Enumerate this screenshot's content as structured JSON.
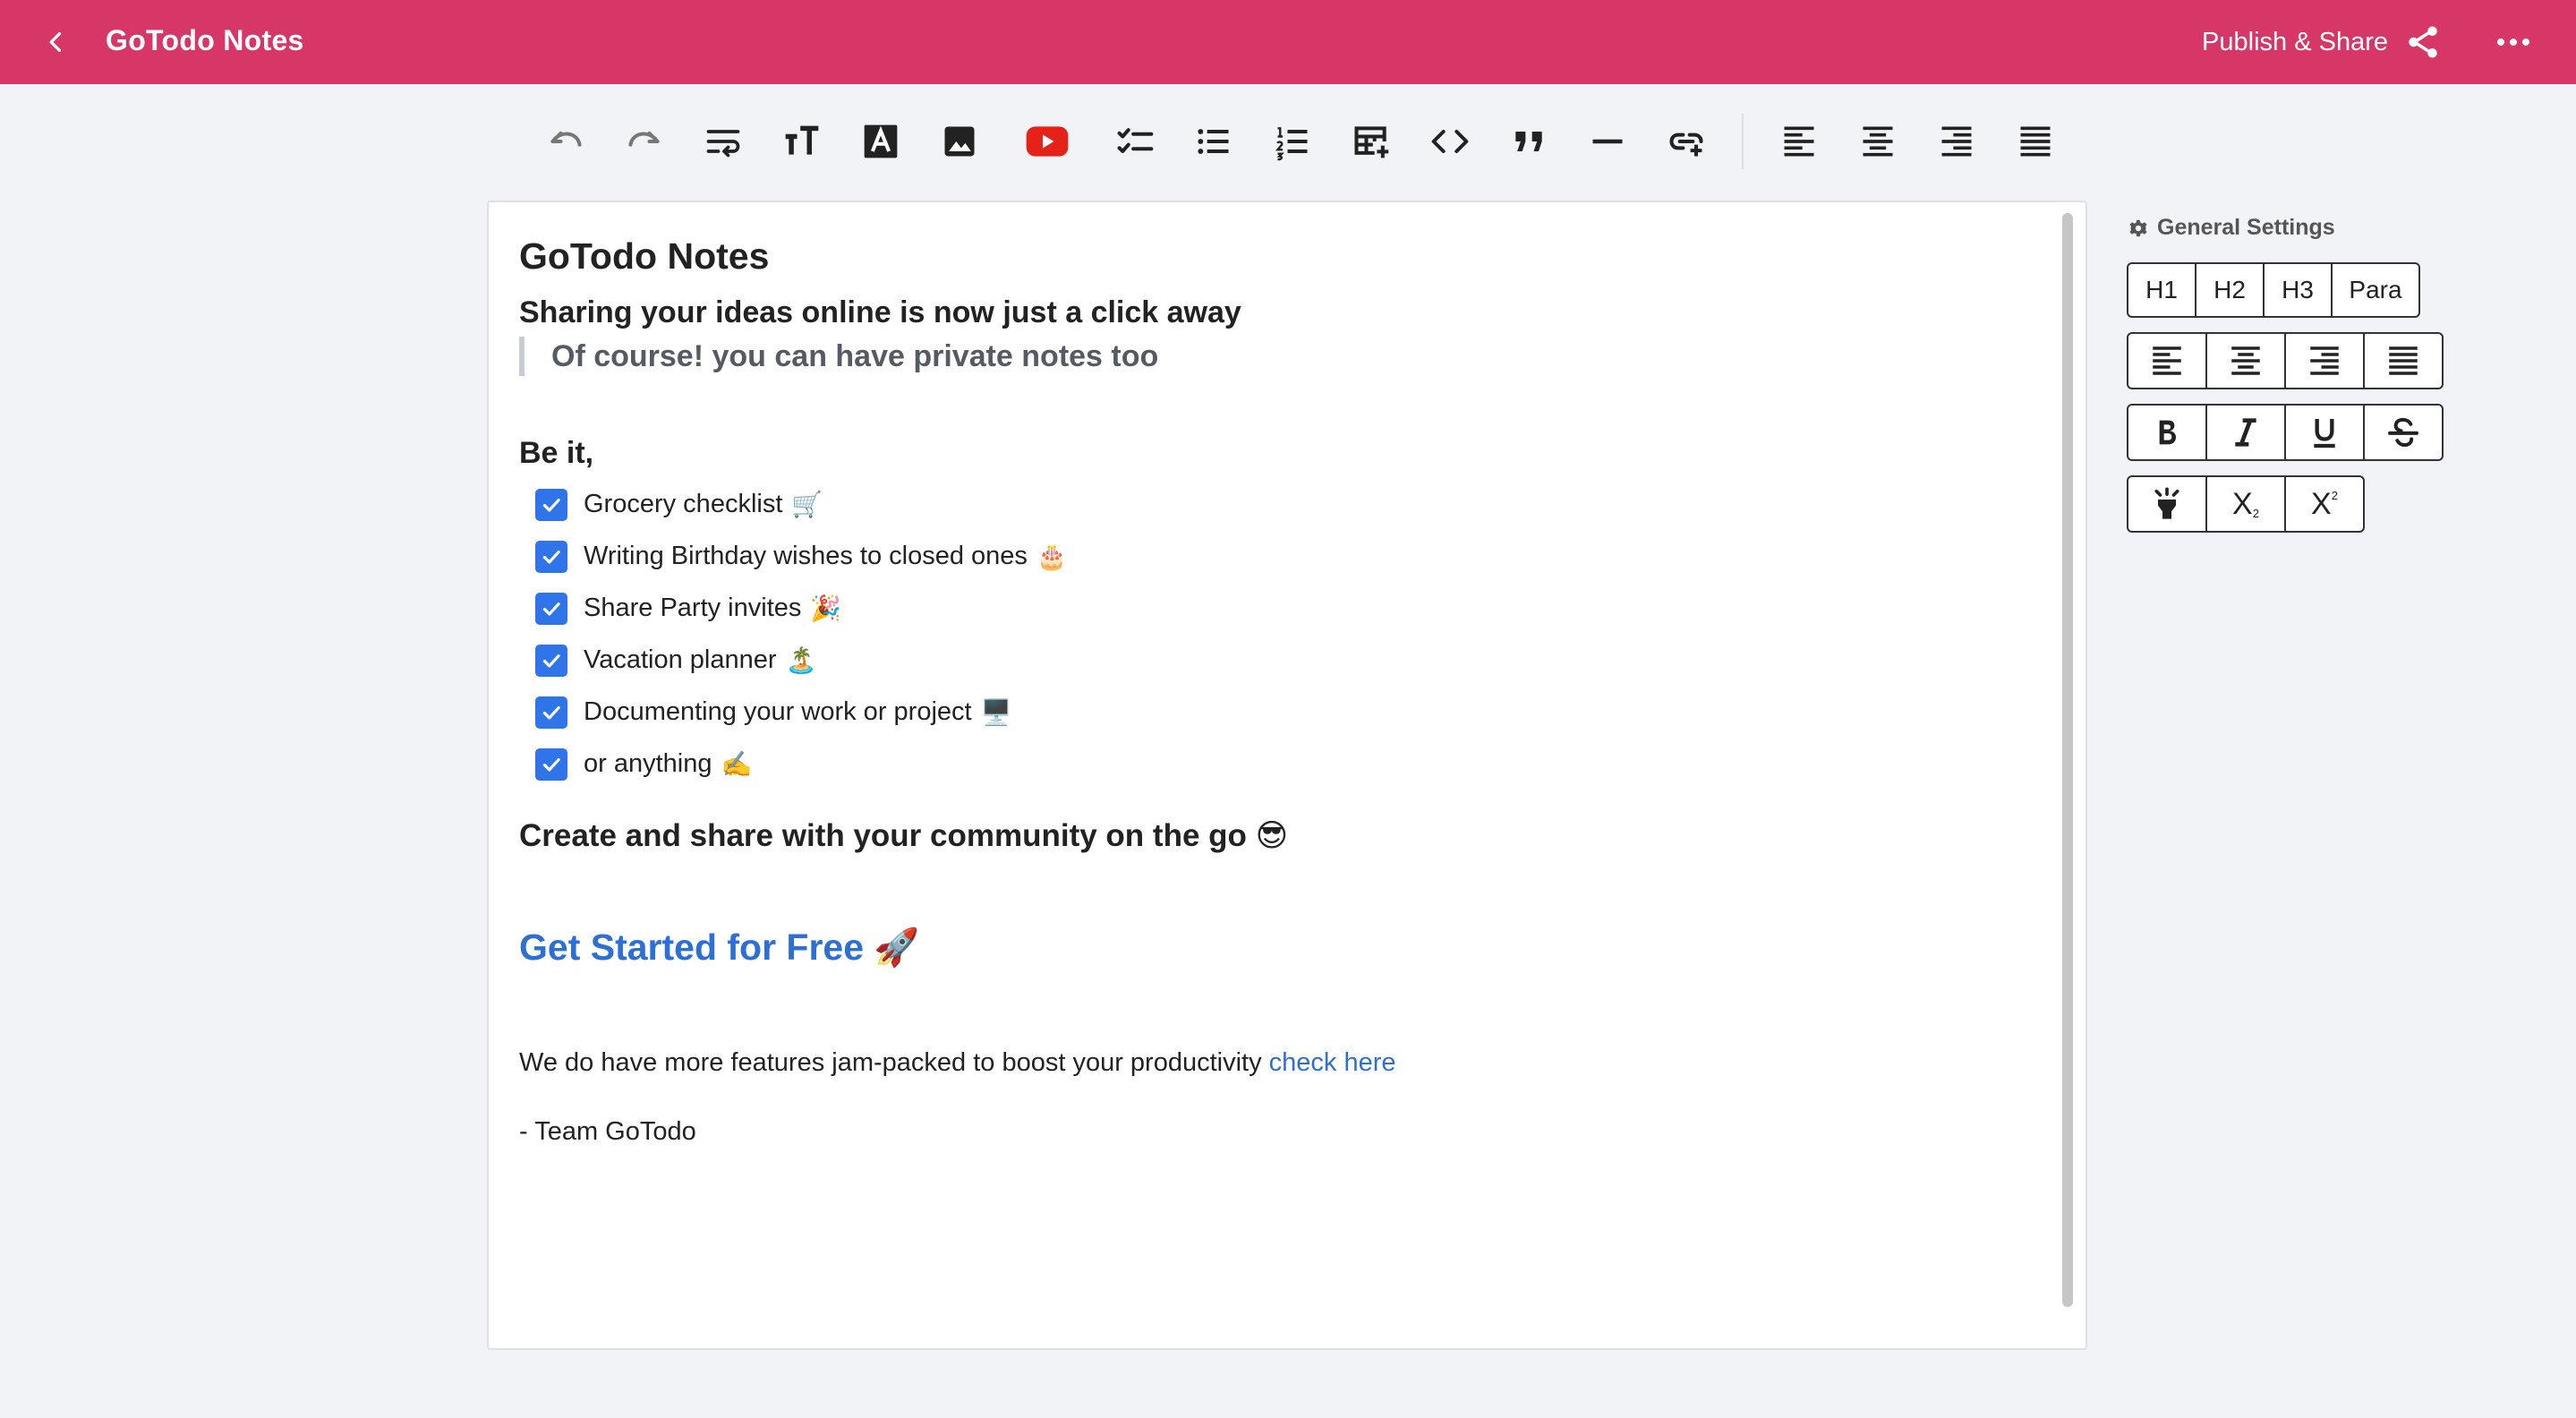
{
  "header": {
    "title": "GoTodo Notes",
    "publish_label": "Publish & Share",
    "background": "#d63766"
  },
  "toolbar": {
    "icons": [
      "undo-icon",
      "redo-icon",
      "wrap-text-icon",
      "text-size-icon",
      "text-color-icon",
      "image-icon",
      "youtube-icon",
      "checklist-icon",
      "bullet-list-icon",
      "numbered-list-icon",
      "insert-table-icon",
      "code-icon",
      "quote-icon",
      "horizontal-rule-icon",
      "insert-link-icon",
      "align-left-icon",
      "align-center-icon",
      "align-right-icon",
      "align-justify-icon"
    ]
  },
  "document": {
    "title": "GoTodo Notes",
    "subtitle": "Sharing your ideas online is now just a click away",
    "quote": "Of course! you can have private notes too",
    "list_heading": "Be it,",
    "checklist": [
      {
        "text": "Grocery checklist",
        "emoji": "🛒",
        "checked": true
      },
      {
        "text": "Writing Birthday wishes to closed ones",
        "emoji": "🎂",
        "checked": true
      },
      {
        "text": "Share Party invites",
        "emoji": "🎉",
        "checked": true
      },
      {
        "text": "Vacation planner",
        "emoji": "🏝️",
        "checked": true
      },
      {
        "text": "Documenting your work or project",
        "emoji": "🖥️",
        "checked": true
      },
      {
        "text": "or anything",
        "emoji": "✍️",
        "checked": true
      }
    ],
    "community_line": "Create and share with your community on the go 😎",
    "cta": "Get Started for Free 🚀",
    "features_text": "We do have more features jam-packed to boost your productivity ",
    "features_link": "check here",
    "signature": "- Team GoTodo",
    "link_color": "#2e6fd6"
  },
  "settings": {
    "title": "General Settings",
    "headings": [
      "H1",
      "H2",
      "H3",
      "Para"
    ],
    "subscript_label": "X",
    "superscript_label": "X"
  }
}
